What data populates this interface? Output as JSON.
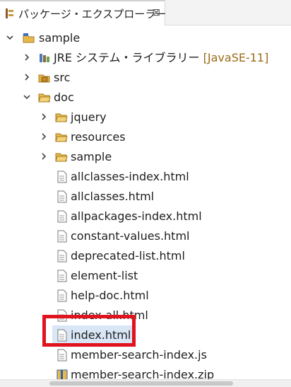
{
  "tab": {
    "title": "パッケージ・エクスプローラー",
    "close_glyph": "⊠"
  },
  "tree": {
    "project": "sample",
    "jre": {
      "label": "JRE システム・ライブラリー",
      "decoration": "[JavaSE-11]"
    },
    "src": "src",
    "doc": {
      "label": "doc",
      "folders": [
        "jquery",
        "resources",
        "sample"
      ],
      "files": [
        "allclasses-index.html",
        "allclasses.html",
        "allpackages-index.html",
        "constant-values.html",
        "deprecated-list.html",
        "element-list",
        "help-doc.html",
        "index-all.html",
        "index.html",
        "member-search-index.js",
        "member-search-index.zip"
      ]
    }
  },
  "colors": {
    "selection": "#d8e6f5",
    "highlight_box": "#e0141e",
    "folder": "#e8b84a"
  }
}
